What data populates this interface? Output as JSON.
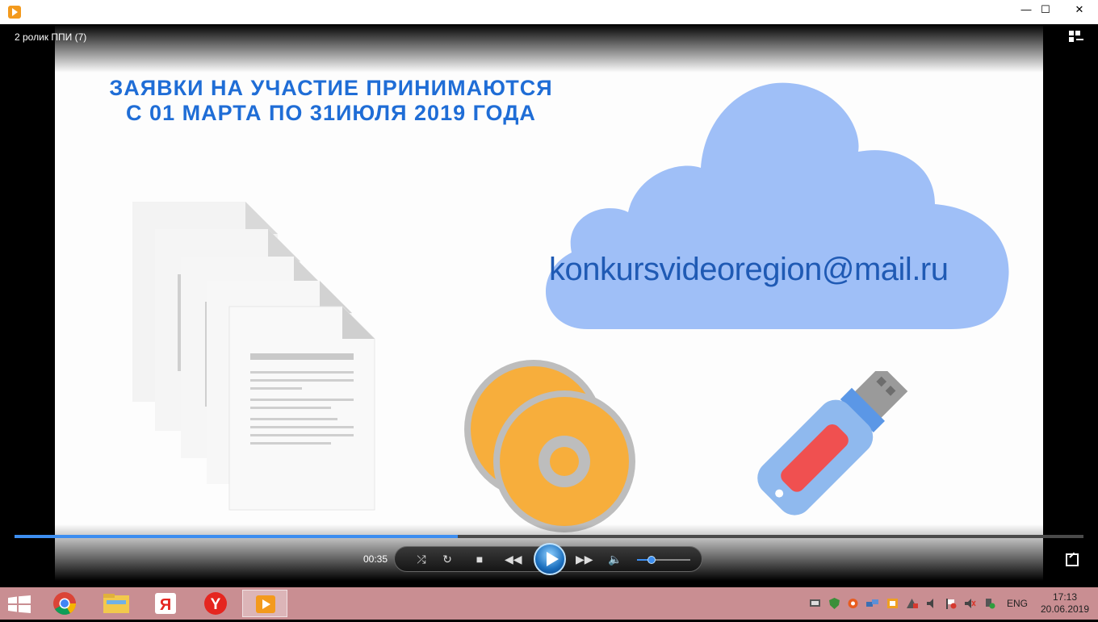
{
  "window": {
    "title_icon": "media-player-icon",
    "minimize_label": "—",
    "maximize_label": "☐",
    "close_label": "✕"
  },
  "player": {
    "video_title": "2 ролик ППИ (7)",
    "current_time": "00:35",
    "progress": 0.415,
    "volume": 0.27
  },
  "video_frame": {
    "headline_line1": "ЗАЯВКИ НА УЧАСТИЕ ПРИНИМАЮТСЯ",
    "headline_line2": "С 01 МАРТА ПО 31ИЮЛЯ 2019 ГОДА",
    "email": "konkursvideoregion@mail.ru",
    "colors": {
      "headline": "#1f6dd6",
      "cloud": "#9fbff7",
      "email": "#1f5ab4",
      "disc": "#f7ae3c",
      "usb_body": "#8fb9ee",
      "usb_red": "#f05050"
    }
  },
  "taskbar": {
    "apps": [
      "chrome-icon",
      "file-explorer-icon",
      "yandex-browser-icon",
      "yandex-icon",
      "media-player-icon"
    ],
    "language": "ENG",
    "time": "17:13",
    "date": "20.06.2019"
  }
}
